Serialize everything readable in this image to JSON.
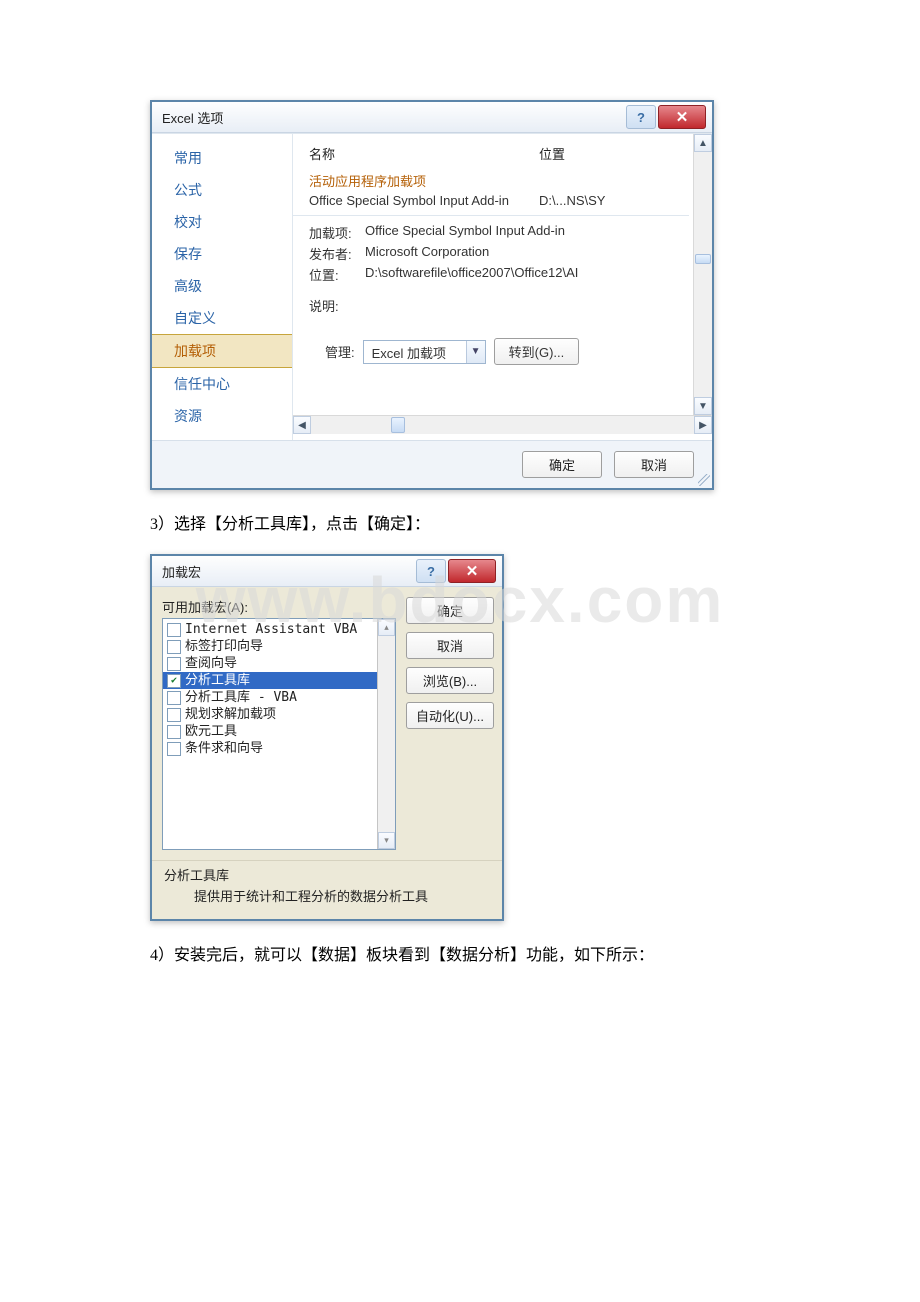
{
  "watermark": "www.bdocx.com",
  "step3_text": "3）选择【分析工具库】，点击【确定】：",
  "step4_text": "4）安装完后，就可以【数据】板块看到【数据分析】功能，如下所示：",
  "excel_options": {
    "title": "Excel 选项",
    "sidebar": [
      {
        "label": "常用"
      },
      {
        "label": "公式"
      },
      {
        "label": "校对"
      },
      {
        "label": "保存"
      },
      {
        "label": "高级"
      },
      {
        "label": "自定义"
      },
      {
        "label": "加载项"
      },
      {
        "label": "信任中心"
      },
      {
        "label": "资源"
      }
    ],
    "sidebar_selected_index": 6,
    "header_name": "名称",
    "header_location": "位置",
    "section_active": "活动应用程序加载项",
    "row_name": "Office Special Symbol Input Add-in",
    "row_location": "D:\\...NS\\SY",
    "details": {
      "addon_label": "加载项:",
      "addon_value": "Office Special Symbol Input Add-in",
      "publisher_label": "发布者:",
      "publisher_value": "Microsoft Corporation",
      "location_label": "位置:",
      "location_value": "D:\\softwarefile\\office2007\\Office12\\AI",
      "desc_label": "说明:"
    },
    "manage_label": "管理:",
    "manage_value": "Excel 加载项",
    "go_label": "转到(G)...",
    "ok_label": "确定",
    "cancel_label": "取消"
  },
  "addins": {
    "title": "加载宏",
    "available_label": "可用加载宏(A):",
    "items": [
      {
        "label": "Internet Assistant VBA",
        "checked": false
      },
      {
        "label": "标签打印向导",
        "checked": false
      },
      {
        "label": "查阅向导",
        "checked": false
      },
      {
        "label": "分析工具库",
        "checked": true
      },
      {
        "label": "分析工具库 - VBA",
        "checked": false
      },
      {
        "label": "规划求解加载项",
        "checked": false
      },
      {
        "label": "欧元工具",
        "checked": false
      },
      {
        "label": "条件求和向导",
        "checked": false
      }
    ],
    "selected_index": 3,
    "buttons": {
      "ok": "确定",
      "cancel": "取消",
      "browse": "浏览(B)...",
      "automation": "自动化(U)..."
    },
    "desc_name": "分析工具库",
    "desc_text": "提供用于统计和工程分析的数据分析工具"
  }
}
